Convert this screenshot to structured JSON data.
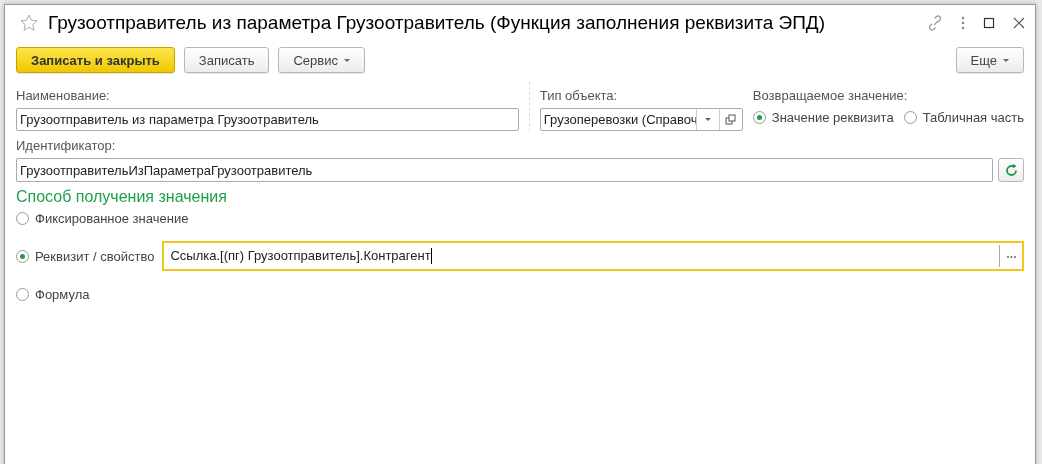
{
  "window": {
    "title": "Грузоотправитель из параметра Грузоотравитель (Функция заполнения реквизита ЭПД)",
    "favorite": false
  },
  "toolbar": {
    "buttons": [
      {
        "label": "Записать и закрыть",
        "kind": "primary"
      },
      {
        "label": "Записать",
        "kind": "plain"
      },
      {
        "label": "Сервис",
        "kind": "menu"
      }
    ],
    "more": "Еще"
  },
  "fields": {
    "name": {
      "label": "Наименование:",
      "value": "Грузоотправитель из параметра Грузоотравитель"
    },
    "object_type": {
      "label": "Тип объекта:",
      "value": "Грузоперевозки (Справоч"
    },
    "return_value": {
      "label": "Возвращаемое значение:",
      "options": [
        {
          "label": "Значение реквизита",
          "selected": true
        },
        {
          "label": "Табличная часть",
          "selected": false
        }
      ]
    },
    "identifier": {
      "label": "Идентификатор:",
      "value": "ГрузоотправительИзПараметраГрузоотравитель"
    }
  },
  "method": {
    "title": "Способ получения значения",
    "options": [
      {
        "label": "Фиксированное значение",
        "selected": false
      },
      {
        "label": "Реквизит / свойство",
        "selected": true,
        "value": "Ссылка.[(пг) Грузоотправитель].Контрагент",
        "focused": true
      },
      {
        "label": "Формула",
        "selected": false
      }
    ]
  }
}
